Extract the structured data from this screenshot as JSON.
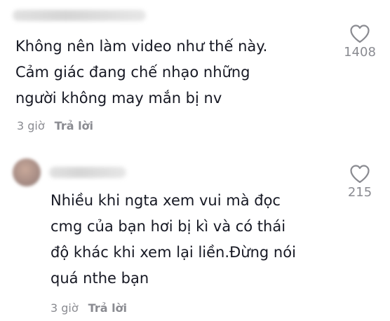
{
  "comments": [
    {
      "text": "Không nên làm video như thế này.\nCảm giác đang chế nhạo những\nngười không may mắn bị nv",
      "time": "3 giờ",
      "reply_label": "Trả lời",
      "likes": "1408",
      "heart_icon": "heart-outline-icon"
    },
    {
      "text": "Nhiều khi ngta xem vui mà đọc\ncmg của bạn hơi bị kì và có thái\nđộ khác khi xem lại liền.Đừng nói\nquá nthe bạn",
      "time": "3 giờ",
      "reply_label": "Trả lời",
      "likes": "215",
      "heart_icon": "heart-outline-icon"
    }
  ],
  "colors": {
    "text": "#161823",
    "secondary": "#8a8b91"
  }
}
